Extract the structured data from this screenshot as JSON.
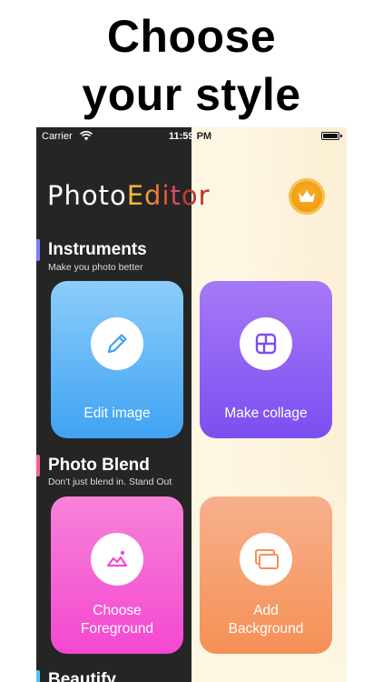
{
  "headline": {
    "line1": "Choose",
    "line2": "your style"
  },
  "status_bar": {
    "carrier": "Carrier",
    "time": "11:59",
    "ampm": "PM"
  },
  "logo": {
    "part1": "Photo",
    "part2": "Edit",
    "part3": "or"
  },
  "premium": {
    "icon": "crown-icon"
  },
  "sections": [
    {
      "title": "Instruments",
      "subtitle": "Make you photo better",
      "accent": "#7b7ff2"
    },
    {
      "title": "Photo Blend",
      "subtitle": "Don't just blend in. Stand Out",
      "accent": "#f06292"
    },
    {
      "title": "Beautify",
      "accent": "#4fc3f7"
    }
  ],
  "cards": {
    "edit_image": {
      "label": "Edit image",
      "icon": "pencil-icon"
    },
    "make_collage": {
      "label": "Make collage",
      "icon": "collage-grid-icon"
    },
    "choose_foreground": {
      "label_line1": "Choose",
      "label_line2": "Foreground",
      "icon": "image-icon"
    },
    "add_background": {
      "label_line1": "Add",
      "label_line2": "Background",
      "icon": "layers-icon"
    }
  },
  "colors": {
    "dark_panel": "#252525",
    "cream_panel": "#fdf6e3",
    "edit_card": "#3fa3f2",
    "collage_card": "#7b4ff0",
    "foreground_card": "#f447d1",
    "background_card": "#f69055",
    "premium_gold": "#f39c12"
  }
}
